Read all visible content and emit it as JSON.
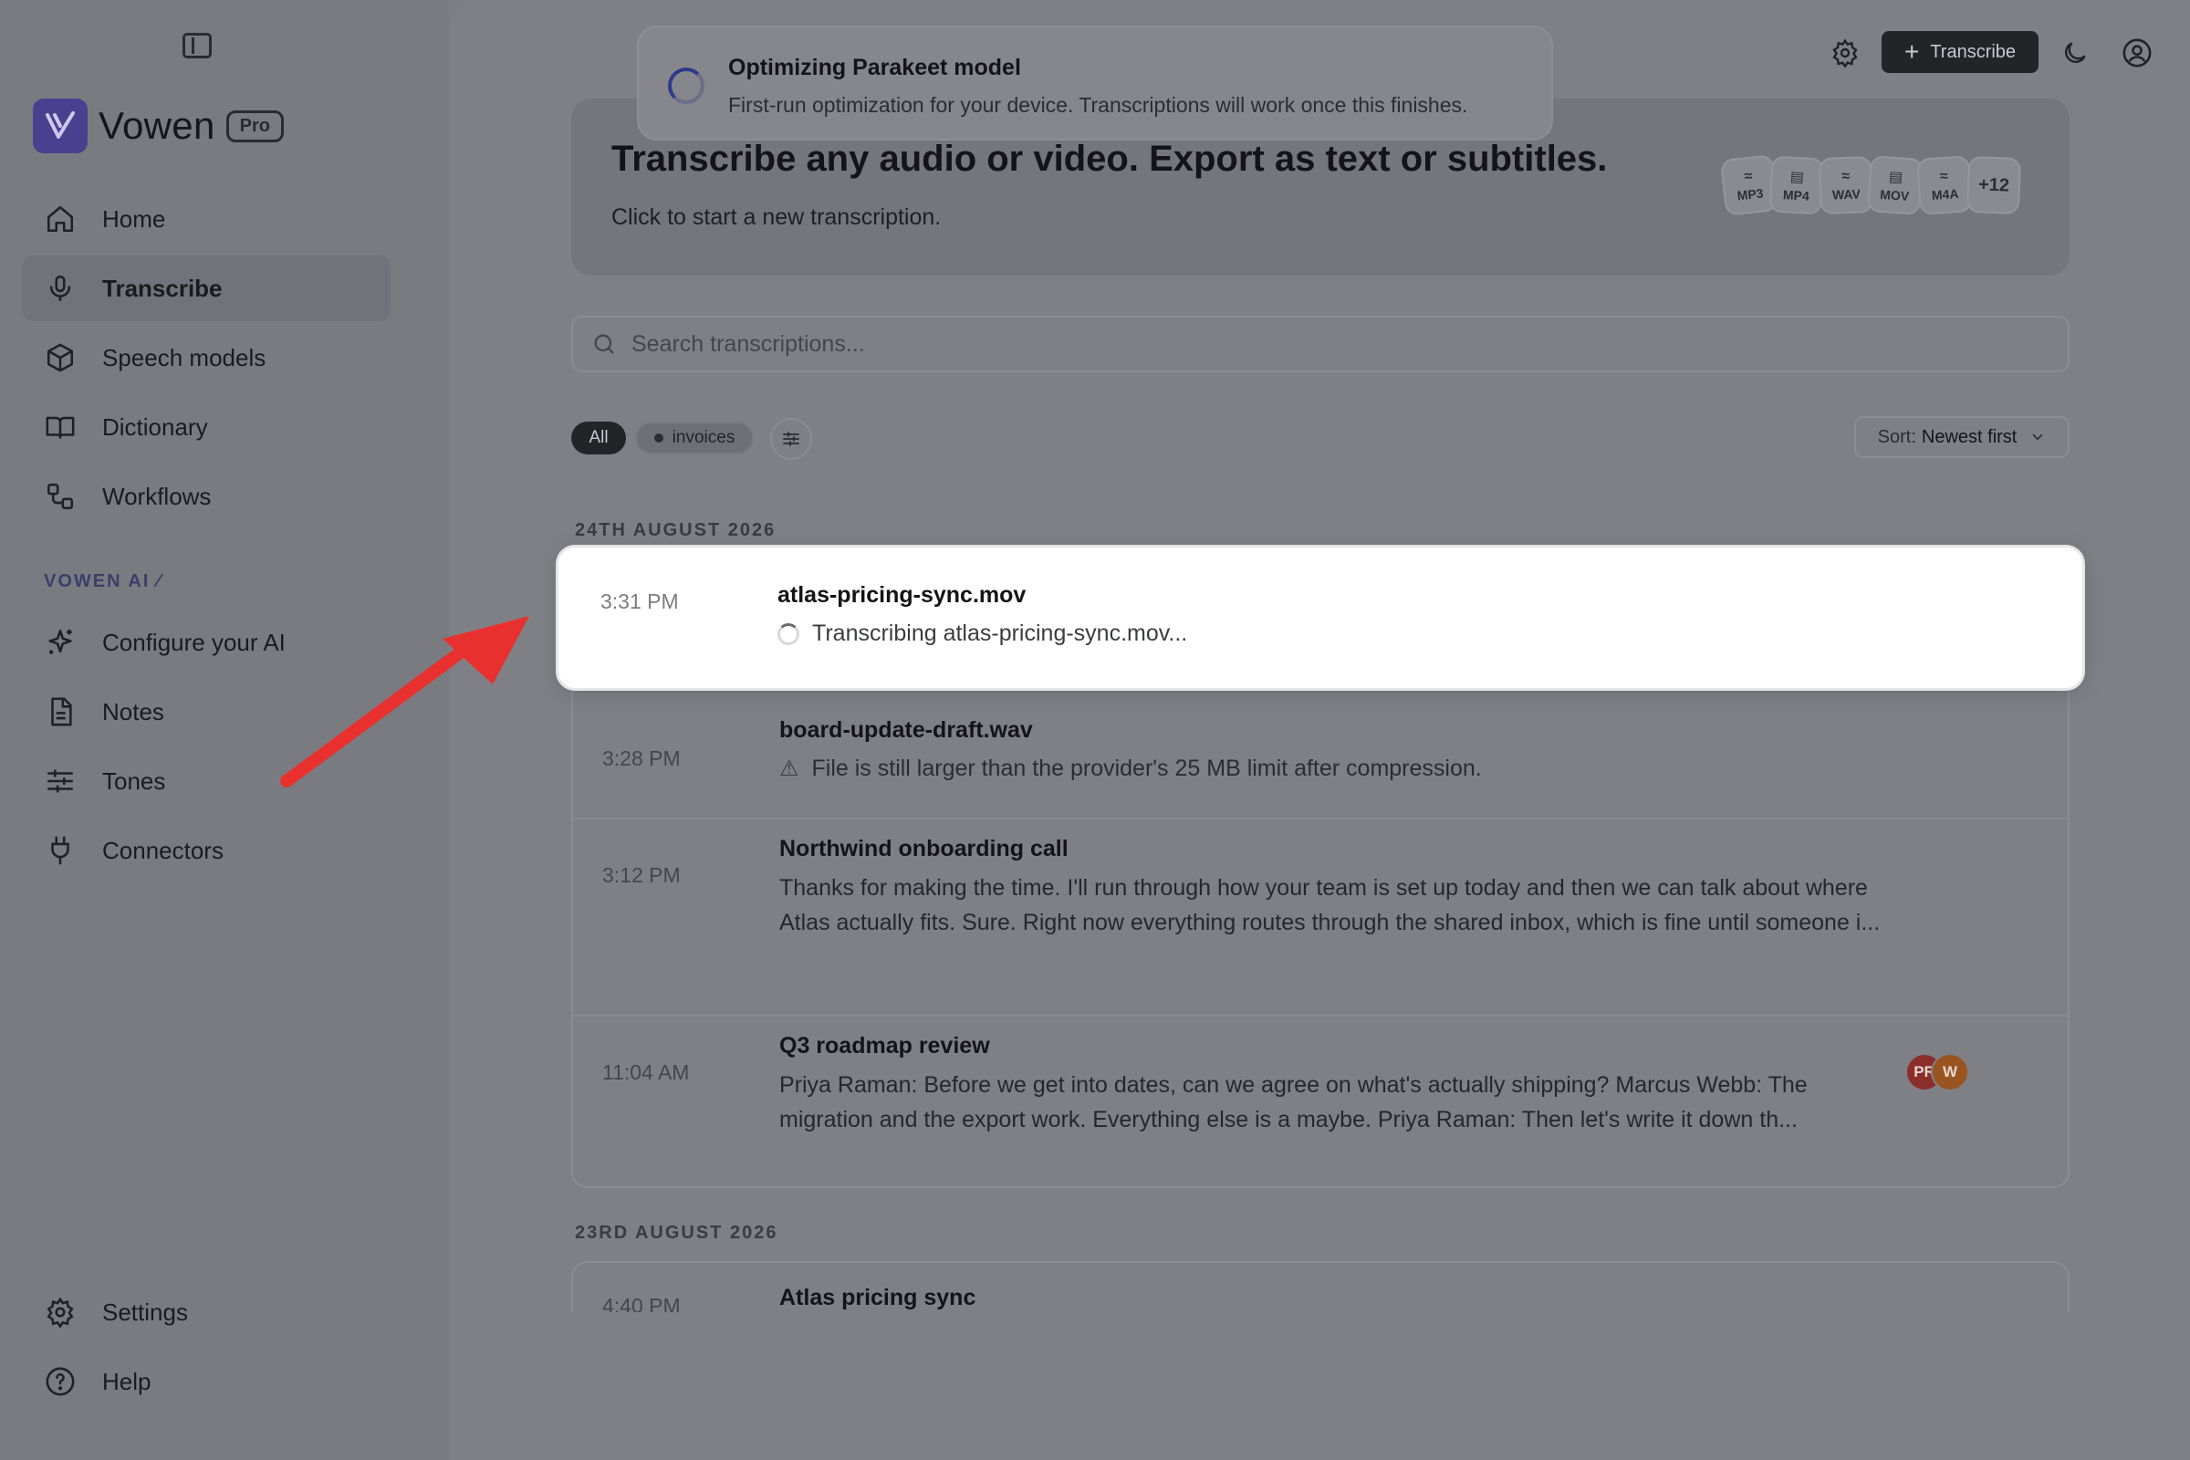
{
  "app": {
    "name": "Vowen",
    "plan_badge": "Pro"
  },
  "sidebar": {
    "items": [
      {
        "label": "Home",
        "icon": "home-icon"
      },
      {
        "label": "Transcribe",
        "icon": "microphone-icon",
        "active": true
      },
      {
        "label": "Speech models",
        "icon": "cube-icon"
      },
      {
        "label": "Dictionary",
        "icon": "book-icon"
      },
      {
        "label": "Workflows",
        "icon": "workflow-icon"
      }
    ],
    "section_label": "VOWEN AI",
    "ai_items": [
      {
        "label": "Configure your AI",
        "icon": "sparkles-icon"
      },
      {
        "label": "Notes",
        "icon": "document-icon"
      },
      {
        "label": "Tones",
        "icon": "sliders-icon"
      },
      {
        "label": "Connectors",
        "icon": "plug-icon"
      }
    ],
    "bottom_items": [
      {
        "label": "Settings",
        "icon": "gear-icon"
      },
      {
        "label": "Help",
        "icon": "help-icon"
      }
    ]
  },
  "topbar": {
    "transcribe_label": "Transcribe"
  },
  "toast": {
    "title": "Optimizing Parakeet model",
    "body": "First-run optimization for your device. Transcriptions will work once this finishes."
  },
  "hero": {
    "title": "Transcribe any audio or video. Export as text or subtitles.",
    "subtitle": "Click to start a new transcription.",
    "formats": [
      "MP3",
      "MP4",
      "WAV",
      "MOV",
      "M4A"
    ],
    "more_formats": "+12"
  },
  "search": {
    "placeholder": "Search transcriptions..."
  },
  "filters": {
    "all_label": "All",
    "tag_label": "invoices",
    "sort_prefix": "Sort:",
    "sort_value": "Newest first"
  },
  "groups": [
    {
      "date": "24TH AUGUST 2026",
      "entries": [
        {
          "time": "3:31 PM",
          "title": "atlas-pricing-sync.mov",
          "status": "Transcribing atlas-pricing-sync.mov..."
        },
        {
          "time": "3:28 PM",
          "title": "board-update-draft.wav",
          "warning": "File is still larger than the provider's 25 MB limit after compression."
        },
        {
          "time": "3:12 PM",
          "title": "Northwind onboarding call",
          "preview_line1": "Thanks for making the time. I'll run through how your team is set up today and then we can talk about where",
          "preview_line2": "Atlas actually fits. Sure. Right now everything routes through the shared inbox, which is fine until someone i..."
        },
        {
          "time": "11:04 AM",
          "title": "Q3 roadmap review",
          "preview_line1": "Priya Raman: Before we get into dates, can we agree on what's actually shipping? Marcus Webb: The",
          "preview_line2": "migration and the export work. Everything else is a maybe. Priya Raman: Then let's write it down th...",
          "participants": [
            "PR",
            "W"
          ]
        }
      ]
    },
    {
      "date": "23RD AUGUST 2026",
      "entries": [
        {
          "time": "4:40 PM",
          "title": "Atlas pricing sync"
        }
      ]
    }
  ],
  "colors": {
    "accent": "#4b3f8f",
    "annotation_arrow": "#e8312f"
  }
}
